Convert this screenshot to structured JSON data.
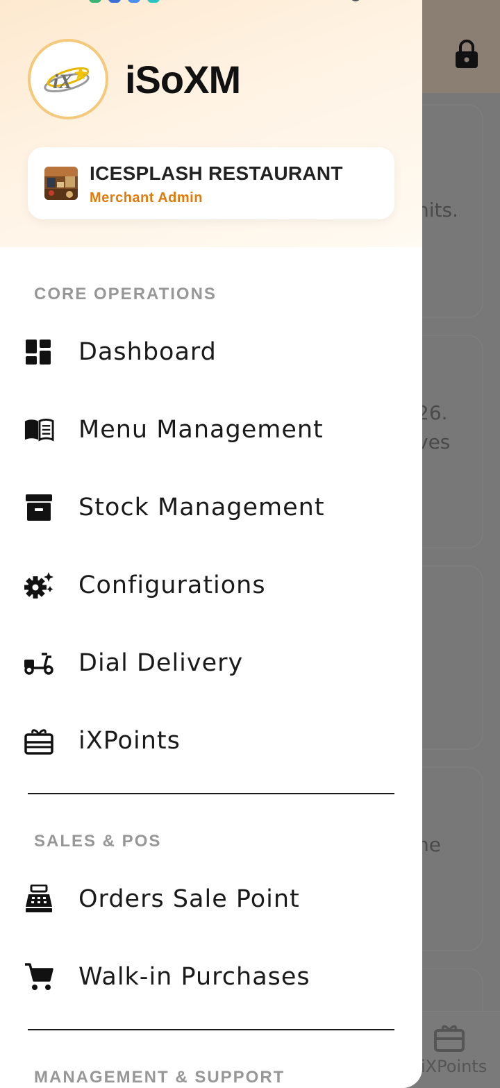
{
  "colors": {
    "accent": "#e07b0a",
    "header_gradient_start": "#fde9cf",
    "header_gradient_end": "#fffaf2",
    "section_label": "#979797",
    "text": "#1a1a1a",
    "scrim": "#787878"
  },
  "background": {
    "partial_texts": [
      "nits.",
      "26.",
      "ves",
      "he"
    ],
    "bottom_nav_label": "iXPoints",
    "lock_icon": "lock-icon"
  },
  "drawer": {
    "brand": {
      "logo_text": "iX",
      "title": "iSoXM"
    },
    "merchant": {
      "name": "ICESPLASH RESTAURANT",
      "role": "Merchant Admin"
    },
    "sections": {
      "core": {
        "label": "CORE OPERATIONS",
        "items": [
          {
            "label": "Dashboard",
            "icon": "dashboard-icon"
          },
          {
            "label": "Menu Management",
            "icon": "menu-book-icon"
          },
          {
            "label": "Stock Management",
            "icon": "archive-box-icon"
          },
          {
            "label": "Configurations",
            "icon": "settings-sparkle-icon"
          },
          {
            "label": "Dial Delivery",
            "icon": "scooter-icon"
          },
          {
            "label": "iXPoints",
            "icon": "gift-card-icon"
          }
        ]
      },
      "sales": {
        "label": "SALES & POS",
        "items": [
          {
            "label": "Orders Sale Point",
            "icon": "cash-register-icon"
          },
          {
            "label": "Walk-in Purchases",
            "icon": "shopping-cart-icon"
          }
        ]
      },
      "management": {
        "label": "MANAGEMENT & SUPPORT"
      }
    }
  }
}
